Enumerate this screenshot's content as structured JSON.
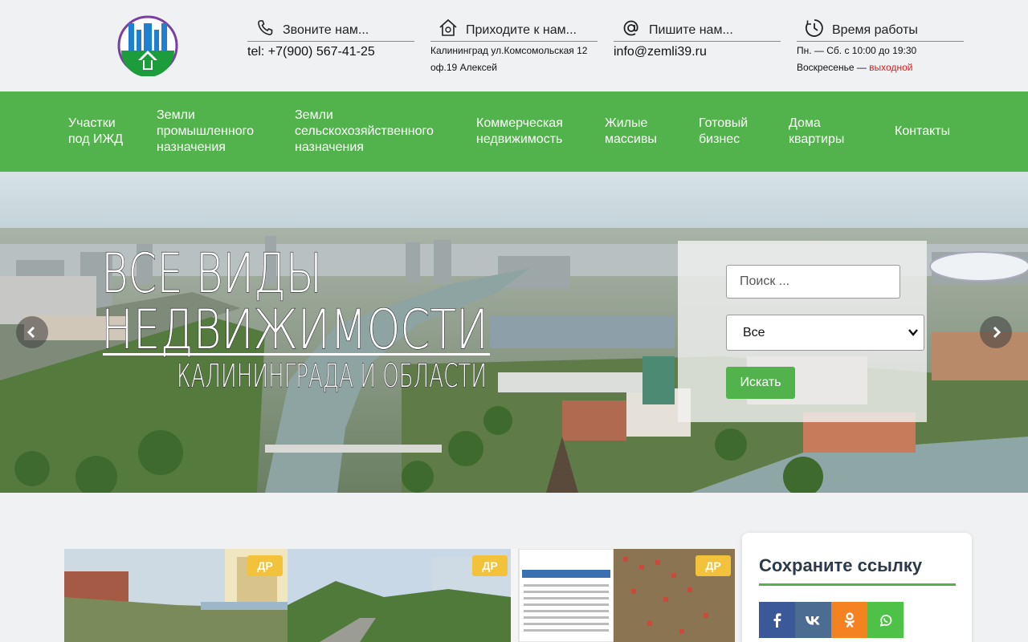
{
  "header": {
    "phone": {
      "title": "Звоните нам...",
      "value": "tel: +7(900) 567-41-25",
      "icon": "phone-icon"
    },
    "address": {
      "title": "Приходите к нам...",
      "line1": "Калининград ул.Комсомольская 12",
      "line2": "оф.19 Алексей",
      "icon": "home-icon"
    },
    "email": {
      "title": "Пишите нам...",
      "value": "info@zemli39.ru",
      "icon": "at-icon"
    },
    "hours": {
      "title": "Время работы",
      "line1": "Пн. — Сб. с 10:00 до 19:30",
      "line2_prefix": "Воскресенье — ",
      "line2_suffix": "выходной",
      "icon": "clock-icon"
    }
  },
  "nav": {
    "items": [
      {
        "label": "Участки\nпод ИЖД"
      },
      {
        "label": "Земли\nпромышленного\nназначения"
      },
      {
        "label": "Земли\nсельскохозяйственного\nназначения"
      },
      {
        "label": "Коммерческая\nнедвижимость"
      },
      {
        "label": "Жилые\nмассивы"
      },
      {
        "label": "Готовый\nбизнес"
      },
      {
        "label": "Дома\nквартиры"
      },
      {
        "label": "Контакты"
      }
    ]
  },
  "hero": {
    "title_line1": "ВСЕ ВИДЫ",
    "title_line2": "НЕДВИЖИМОСТИ",
    "subtitle": "КАЛИНИНГРАДА И ОБЛАСТИ",
    "search": {
      "placeholder": "Поиск ...",
      "select_value": "Все",
      "button": "Искать"
    }
  },
  "listings": {
    "badge": "ДР"
  },
  "sidebar": {
    "title": "Сохраните ссылку",
    "share": [
      {
        "name": "facebook",
        "label": "f",
        "color": "#3b5998"
      },
      {
        "name": "vk",
        "label": "vk",
        "color": "#4c6c91"
      },
      {
        "name": "odnoklassniki",
        "label": "ok",
        "color": "#f58220"
      },
      {
        "name": "whatsapp",
        "label": "wa",
        "color": "#4dc247"
      }
    ]
  },
  "colors": {
    "accent": "#52b24b",
    "header_bg": "#eff1f3",
    "badge": "#f2c23a"
  }
}
